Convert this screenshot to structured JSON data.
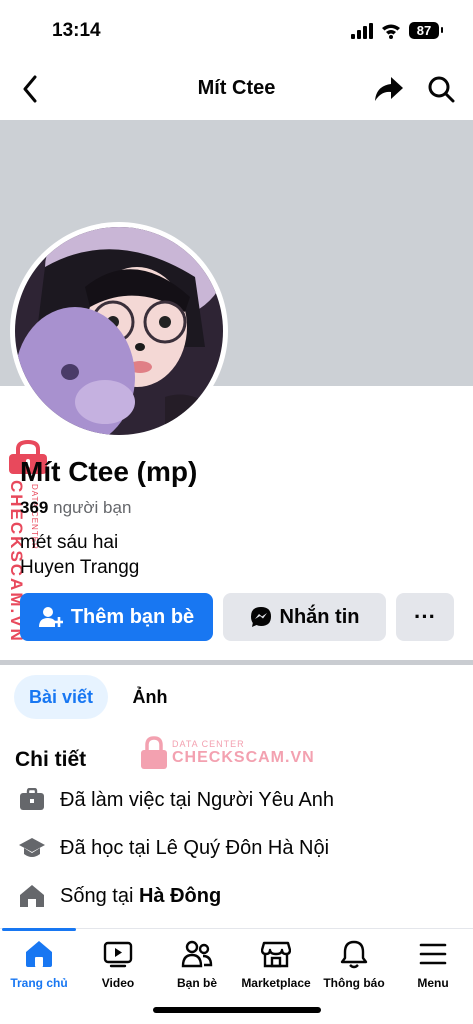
{
  "status": {
    "time": "13:14",
    "battery": "87"
  },
  "nav": {
    "title": "Mít Ctee"
  },
  "profile": {
    "name": "Mít Ctee (mp)",
    "friends_count": "369",
    "friends_label": "người bạn",
    "bio": [
      "mét sáu hai",
      "Huyen Trangg"
    ]
  },
  "actions": {
    "add_friend": "Thêm bạn bè",
    "message": "Nhắn tin",
    "more": "···"
  },
  "tabs": [
    {
      "label": "Bài viết",
      "active": true
    },
    {
      "label": "Ảnh",
      "active": false
    }
  ],
  "details": {
    "title": "Chi tiết",
    "work_prefix": "Đã làm việc tại ",
    "work_place": "Người Yêu Anh",
    "study_prefix": "Đã học tại ",
    "study_place": "Lê Quý Đôn Hà Nội",
    "live_prefix": "Sống tại ",
    "live_place": "Hà Đông"
  },
  "watermark": {
    "brand": "CHECKSCAM.VN",
    "sub": "DATA CENTER"
  },
  "tabbar": [
    {
      "label": "Trang chủ",
      "icon": "home-icon",
      "active": true
    },
    {
      "label": "Video",
      "icon": "video-icon",
      "active": false
    },
    {
      "label": "Bạn bè",
      "icon": "friends-icon",
      "active": false
    },
    {
      "label": "Marketplace",
      "icon": "marketplace-icon",
      "active": false
    },
    {
      "label": "Thông báo",
      "icon": "bell-icon",
      "active": false
    },
    {
      "label": "Menu",
      "icon": "menu-icon",
      "active": false
    }
  ],
  "colors": {
    "accent": "#1877f2",
    "cover": "#ccd0d5",
    "watermark": "#e8495c"
  }
}
